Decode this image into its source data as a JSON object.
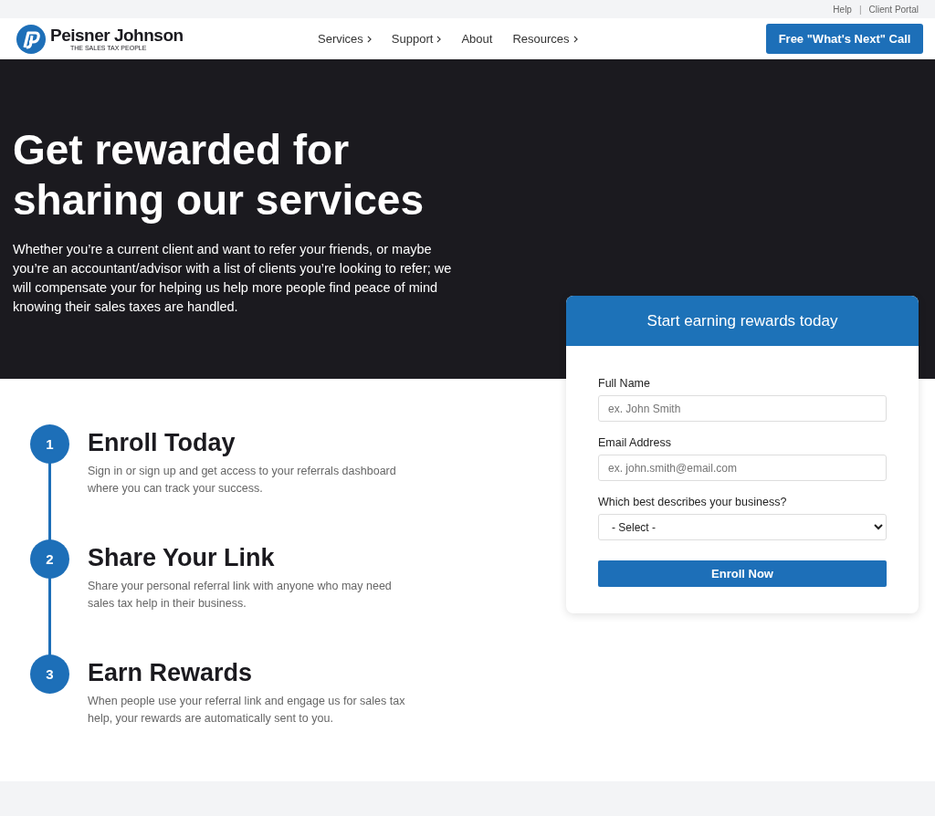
{
  "utility_links": [
    "Help",
    "Client Portal"
  ],
  "utility_separator": "|",
  "logo": {
    "name": "Peisner Johnson",
    "tagline": "THE SALES TAX PEOPLE"
  },
  "nav": [
    {
      "label": "Services",
      "has_submenu": true
    },
    {
      "label": "Support",
      "has_submenu": true
    },
    {
      "label": "About",
      "has_submenu": false
    },
    {
      "label": "Resources",
      "has_submenu": true
    }
  ],
  "cta_button": "Free \"What's Next\" Call",
  "hero": {
    "title": "Get rewarded for sharing our services",
    "text": "Whether you’re a current client and want to refer your friends, or maybe you’re an accountant/advisor with a list of clients you’re looking to refer; we will compensate your for helping us help more people find peace of mind knowing their sales taxes are handled."
  },
  "form": {
    "title": "Start earning rewards today",
    "fields": [
      {
        "kind": "text",
        "label": "Full Name",
        "placeholder": "ex. John Smith"
      },
      {
        "kind": "text",
        "label": "Email Address",
        "placeholder": "ex. john.smith@email.com"
      },
      {
        "kind": "select",
        "label": "Which best describes your business?",
        "value": "- Select -"
      }
    ],
    "submit": "Enroll Now"
  },
  "steps": [
    {
      "number": "1",
      "title": "Enroll Today",
      "text": "Sign in or sign up and get access to your referrals dashboard where you can track your success."
    },
    {
      "number": "2",
      "title": "Share Your Link",
      "text": "Share your personal referral link with anyone who may need sales tax help in their business."
    },
    {
      "number": "3",
      "title": "Earn Rewards",
      "text": "When people use your referral link and engage us for sales tax help, your rewards are automatically sent to you."
    }
  ]
}
